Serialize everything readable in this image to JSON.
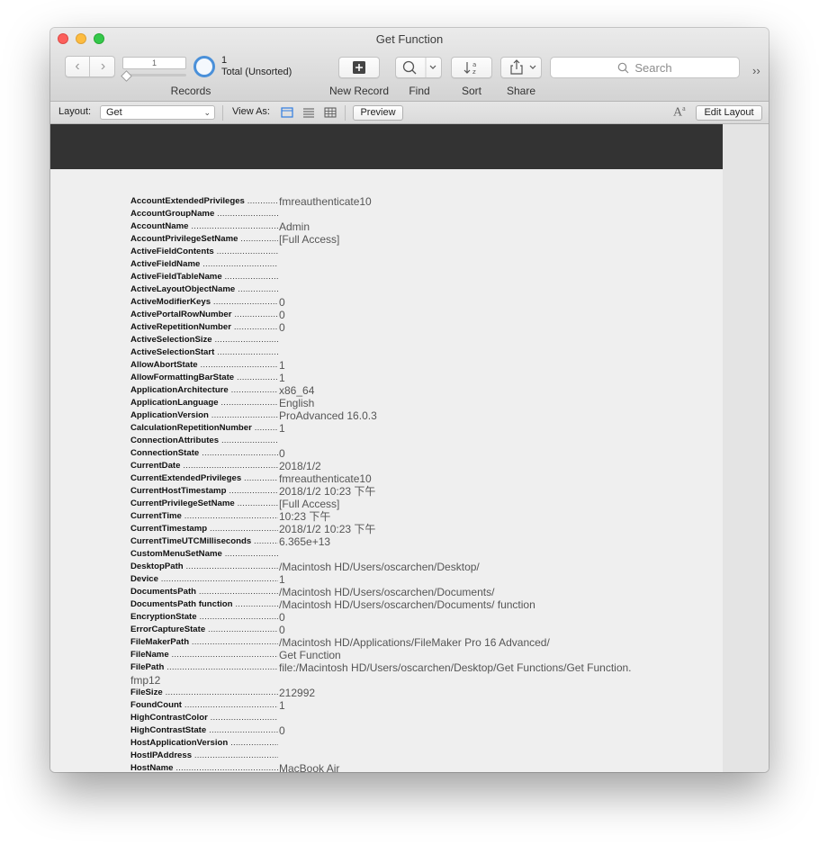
{
  "window": {
    "title": "Get Function"
  },
  "toolbar": {
    "record_number": "1",
    "found_count": "1",
    "total_label": "Total (Unsorted)",
    "records_label": "Records",
    "new_record_label": "New Record",
    "find_label": "Find",
    "sort_label": "Sort",
    "share_label": "Share",
    "search_placeholder": "Search"
  },
  "layout_bar": {
    "layout_label": "Layout:",
    "layout_value": "Get",
    "view_as_label": "View As:",
    "preview_label": "Preview",
    "edit_layout_label": "Edit Layout"
  },
  "fields": [
    {
      "name": "AccountExtendedPrivileges",
      "value": "fmreauthenticate10"
    },
    {
      "name": "AccountGroupName",
      "value": ""
    },
    {
      "name": "AccountName",
      "value": "Admin"
    },
    {
      "name": "AccountPrivilegeSetName",
      "value": "[Full Access]"
    },
    {
      "name": "ActiveFieldContents",
      "value": ""
    },
    {
      "name": "ActiveFieldName",
      "value": ""
    },
    {
      "name": "ActiveFieldTableName",
      "value": ""
    },
    {
      "name": "ActiveLayoutObjectName",
      "value": ""
    },
    {
      "name": "ActiveModifierKeys",
      "value": "0"
    },
    {
      "name": "ActivePortalRowNumber",
      "value": "0"
    },
    {
      "name": "ActiveRepetitionNumber",
      "value": "0"
    },
    {
      "name": "ActiveSelectionSize",
      "value": ""
    },
    {
      "name": "ActiveSelectionStart",
      "value": ""
    },
    {
      "name": "AllowAbortState",
      "value": "1"
    },
    {
      "name": "AllowFormattingBarState",
      "value": "1"
    },
    {
      "name": "ApplicationArchitecture",
      "value": "x86_64"
    },
    {
      "name": "ApplicationLanguage",
      "value": "English"
    },
    {
      "name": "ApplicationVersion",
      "value": "ProAdvanced 16.0.3"
    },
    {
      "name": "CalculationRepetitionNumber",
      "value": "1"
    },
    {
      "name": "ConnectionAttributes",
      "value": ""
    },
    {
      "name": "ConnectionState",
      "value": "0"
    },
    {
      "name": "CurrentDate",
      "value": "2018/1/2"
    },
    {
      "name": "CurrentExtendedPrivileges",
      "value": "fmreauthenticate10"
    },
    {
      "name": "CurrentHostTimestamp",
      "value": "2018/1/2 10:23 下午"
    },
    {
      "name": "CurrentPrivilegeSetName",
      "value": "[Full Access]"
    },
    {
      "name": "CurrentTime",
      "value": "10:23 下午"
    },
    {
      "name": "CurrentTimestamp",
      "value": "2018/1/2 10:23 下午"
    },
    {
      "name": "CurrentTimeUTCMilliseconds",
      "value": "6.365e+13"
    },
    {
      "name": "CustomMenuSetName",
      "value": ""
    },
    {
      "name": "DesktopPath",
      "value": "/Macintosh HD/Users/oscarchen/Desktop/"
    },
    {
      "name": "Device",
      "value": "1"
    },
    {
      "name": "DocumentsPath",
      "value": "/Macintosh HD/Users/oscarchen/Documents/"
    },
    {
      "name": "DocumentsPath function",
      "value": "/Macintosh HD/Users/oscarchen/Documents/ function"
    },
    {
      "name": "EncryptionState",
      "value": "0"
    },
    {
      "name": "ErrorCaptureState",
      "value": "0"
    },
    {
      "name": "FileMakerPath",
      "value": "/Macintosh HD/Applications/FileMaker Pro 16 Advanced/"
    },
    {
      "name": "FileName",
      "value": "Get Function"
    },
    {
      "name": "FilePath",
      "value": "file:/Macintosh HD/Users/oscarchen/Desktop/Get Functions/Get Function.",
      "value2": "fmp12"
    },
    {
      "name": "FileSize",
      "value": "212992"
    },
    {
      "name": "FoundCount",
      "value": "1"
    },
    {
      "name": "HighContrastColor",
      "value": ""
    },
    {
      "name": "HighContrastState",
      "value": "0"
    },
    {
      "name": "HostApplicationVersion",
      "value": ""
    },
    {
      "name": "HostIPAddress",
      "value": ""
    },
    {
      "name": "HostName",
      "value": "MacBook Air"
    }
  ]
}
